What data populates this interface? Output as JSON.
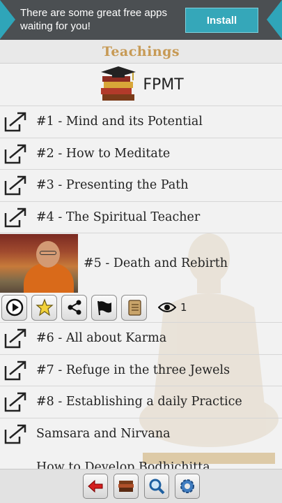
{
  "ad": {
    "text": "There are some great free apps waiting for you!",
    "install_label": "Install"
  },
  "page": {
    "title": "Teachings"
  },
  "header": {
    "org": "FPMT"
  },
  "items_top": [
    {
      "label": "#1 - Mind and its Potential"
    },
    {
      "label": "#2 - How to Meditate"
    },
    {
      "label": "#3 - Presenting the Path"
    },
    {
      "label": "#4 - The Spiritual Teacher"
    }
  ],
  "featured": {
    "label": "#5 - Death and Rebirth",
    "views": "1"
  },
  "items_bottom": [
    {
      "label": "#6 - All about Karma"
    },
    {
      "label": "#7 - Refuge in the three Jewels"
    },
    {
      "label": "#8 - Establishing a daily Practice"
    },
    {
      "label": "Samsara and Nirvana"
    }
  ],
  "partial_item": {
    "label": "How to Develop Bodhichitta"
  },
  "colors": {
    "title": "#c79a55",
    "ad_accent": "#35a7b9"
  }
}
